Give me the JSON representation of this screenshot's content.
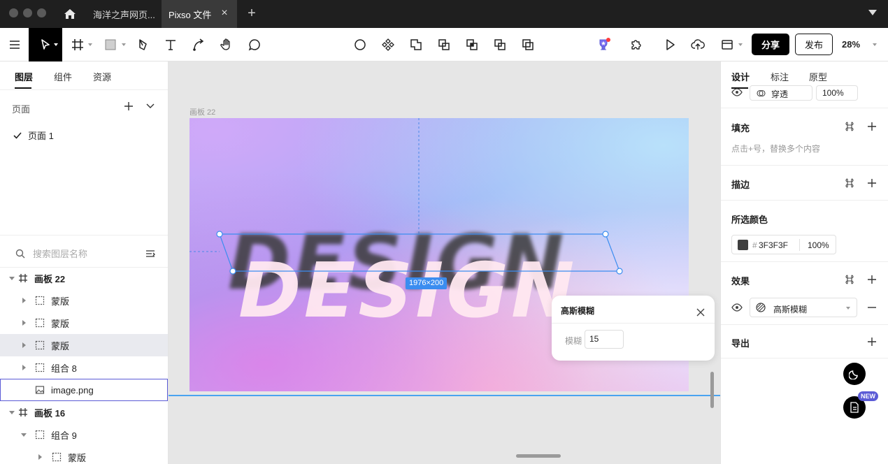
{
  "window": {
    "tabs": [
      {
        "label": "海洋之声网页..."
      },
      {
        "label": "Pixso 文件"
      }
    ]
  },
  "toolbar": {
    "share_label": "分享",
    "publish_label": "发布",
    "zoom": "28%"
  },
  "left_panel": {
    "tabs": [
      {
        "label": "图层"
      },
      {
        "label": "组件"
      },
      {
        "label": "资源"
      }
    ],
    "pages_label": "页面",
    "page_item": "页面 1",
    "search_placeholder": "搜索图层名称",
    "layers": [
      {
        "name": "画板 22"
      },
      {
        "name": "蒙版"
      },
      {
        "name": "蒙版"
      },
      {
        "name": "蒙版"
      },
      {
        "name": "组合 8"
      },
      {
        "name": "image.png"
      },
      {
        "name": "画板 16"
      },
      {
        "name": "组合 9"
      },
      {
        "name": "蒙版"
      }
    ]
  },
  "canvas": {
    "frame_label": "画板 22",
    "design_text": "DESIGN",
    "size_badge": "1976×200"
  },
  "blur_popup": {
    "title": "高斯模糊",
    "field_label": "模糊",
    "field_value": "15"
  },
  "right_panel": {
    "tabs": [
      {
        "label": "设计"
      },
      {
        "label": "标注"
      },
      {
        "label": "原型"
      }
    ],
    "layer_blend": "穿透",
    "layer_opacity": "100%",
    "fill": {
      "title": "填充",
      "hint": "点击+号，替换多个内容"
    },
    "stroke": {
      "title": "描边"
    },
    "selected_colors": {
      "title": "所选颜色",
      "hash": "#",
      "hex": "3F3F3F",
      "opacity": "100%"
    },
    "effects": {
      "title": "效果",
      "effect_name": "高斯模糊"
    },
    "export": {
      "title": "导出"
    },
    "new_badge": "NEW"
  },
  "colors": {
    "accent": "#3b8df0",
    "brand_black": "#000000",
    "badge_purple": "#5b5bd6"
  }
}
